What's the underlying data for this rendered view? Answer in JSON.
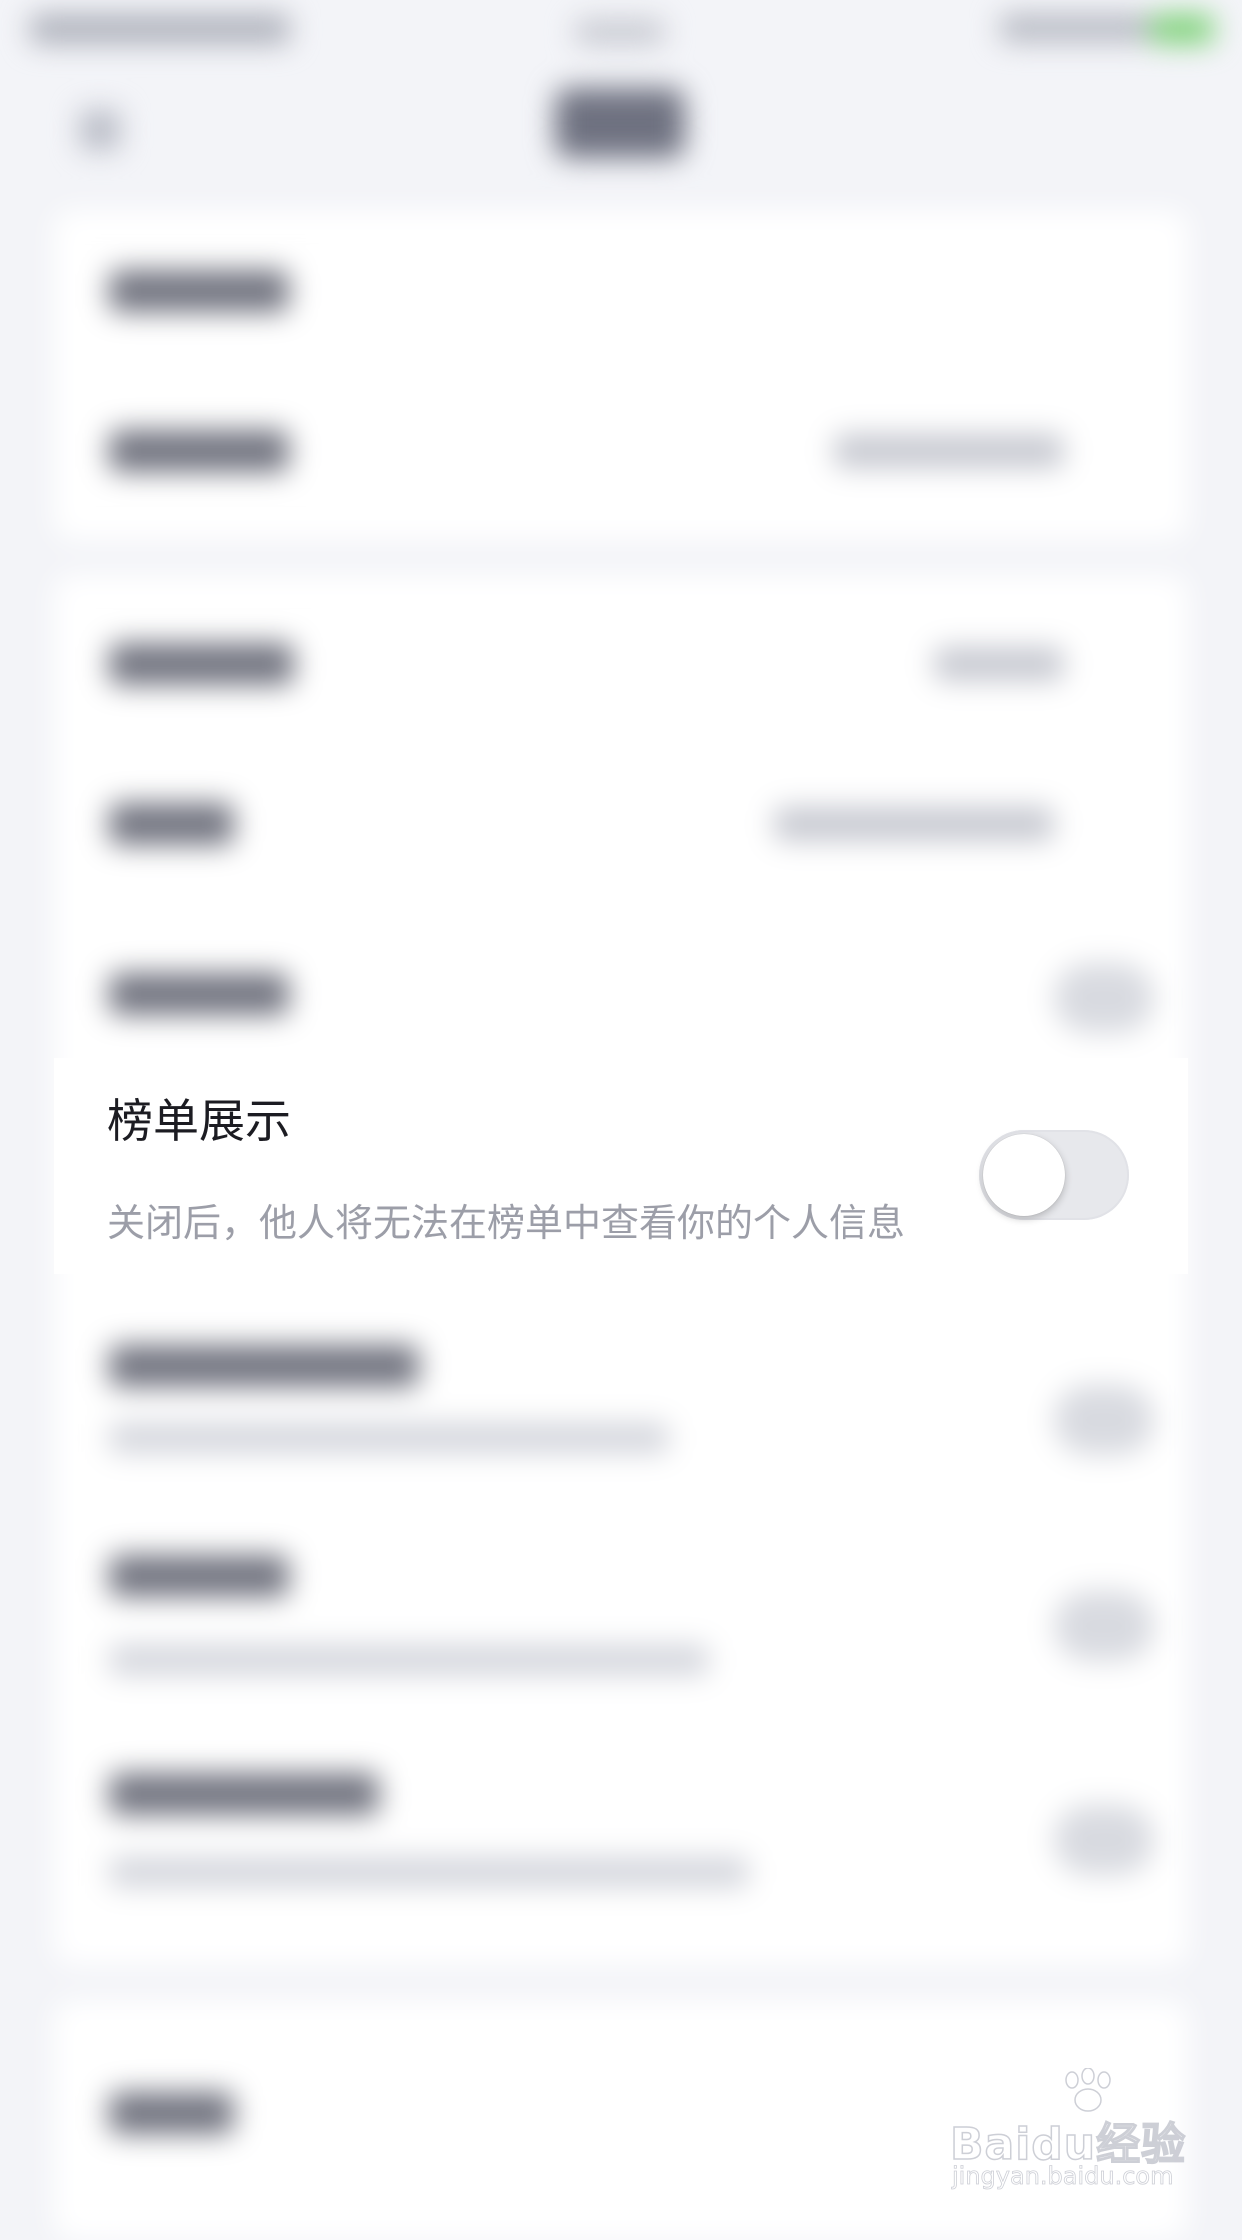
{
  "setting": {
    "title": "榜单展示",
    "description": "关闭后，他人将无法在榜单中查看你的个人信息",
    "toggle_on": false
  },
  "watermark": {
    "brand": "Baidu经验",
    "url": "jingyan.baidu.com"
  },
  "colors": {
    "background": "#f3f4f8",
    "card": "#ffffff",
    "title_text": "#1c1c22",
    "description_text": "#9c9ea8",
    "toggle_track_off": "#e7e8ec"
  }
}
